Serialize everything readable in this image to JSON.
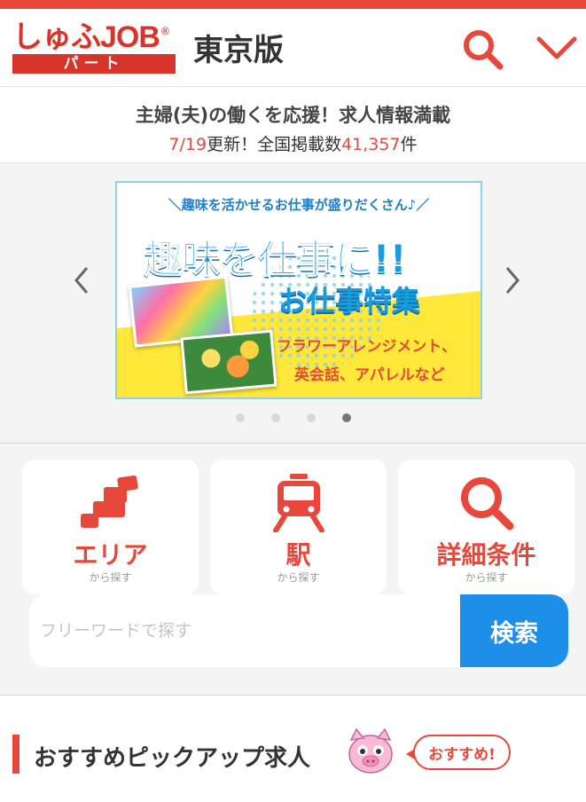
{
  "header": {
    "logo_main": "しゅふJOB",
    "logo_reg": "®",
    "logo_sub": "パート",
    "edition": "東京版",
    "search_icon": "search-icon",
    "menu_icon": "chevron-down-icon"
  },
  "tagline": {
    "line1": "主婦(夫)の働くを応援！求人情報満載",
    "date": "7/19",
    "updated": "更新！全国掲載数",
    "count": "41,357",
    "unit": "件"
  },
  "banner": {
    "top_text": "＼趣味を活かせるお仕事が盛りだくさん♪／",
    "title": "趣味を仕事に!!",
    "subtitle": "お仕事特集",
    "line1": "フラワーアレンジメント、",
    "line2": "英会話、アパレルなど",
    "page_count": 4,
    "active_page": 4
  },
  "cards": [
    {
      "label": "エリア",
      "sub": "から探す",
      "icon": "map-icon"
    },
    {
      "label": "駅",
      "sub": "から探す",
      "icon": "train-icon"
    },
    {
      "label": "詳細条件",
      "sub": "から探す",
      "icon": "search-icon"
    }
  ],
  "freeword": {
    "placeholder": "フリーワードで探す",
    "button": "検索"
  },
  "section": {
    "title": "おすすめピックアップ求人",
    "badge": "おすすめ!"
  },
  "colors": {
    "accent": "#e8483c",
    "button_blue": "#1e8fe8",
    "background": "#f4f4f4"
  }
}
